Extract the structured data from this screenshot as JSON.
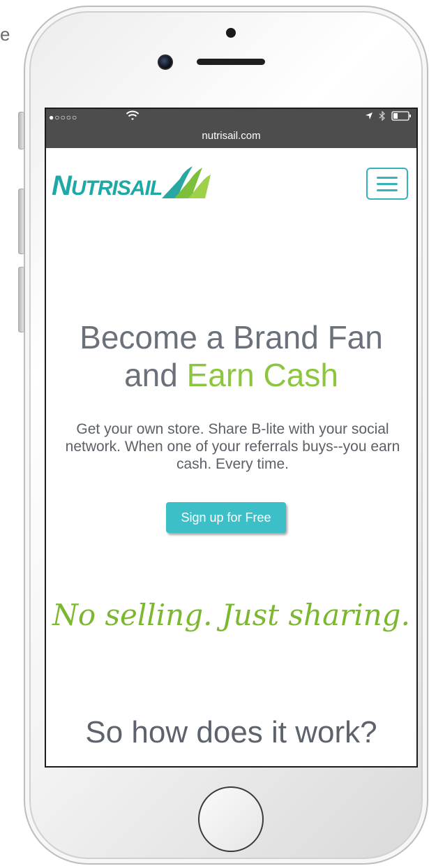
{
  "edge_text": "e",
  "browser": {
    "signal_text": "●○○○○",
    "url": "nutrisail.com",
    "icons": [
      "wifi-icon",
      "location-arrow-icon",
      "bluetooth-icon",
      "battery-icon"
    ]
  },
  "site": {
    "logo_text_initial": "N",
    "logo_text_rest": "UTRISAIL",
    "menu_icon": "hamburger-menu-icon",
    "hero_title_line1": "Become a Brand Fan",
    "hero_title_line2_plain": "and ",
    "hero_title_line2_accent": "Earn Cash",
    "hero_body": "Get your own store. Share B-lite with your social network. When one of your referrals buys--you earn cash. Every time.",
    "cta_label": "Sign up for Free",
    "tagline": "No selling. Just sharing.",
    "how_heading": "So how does it work?"
  },
  "colors": {
    "brand_teal": "#1fa9a6",
    "brand_green": "#8cc63f",
    "cta_bg": "#3dbfc8",
    "text_gray": "#6b717a",
    "status_bar": "#4d4d4d"
  }
}
